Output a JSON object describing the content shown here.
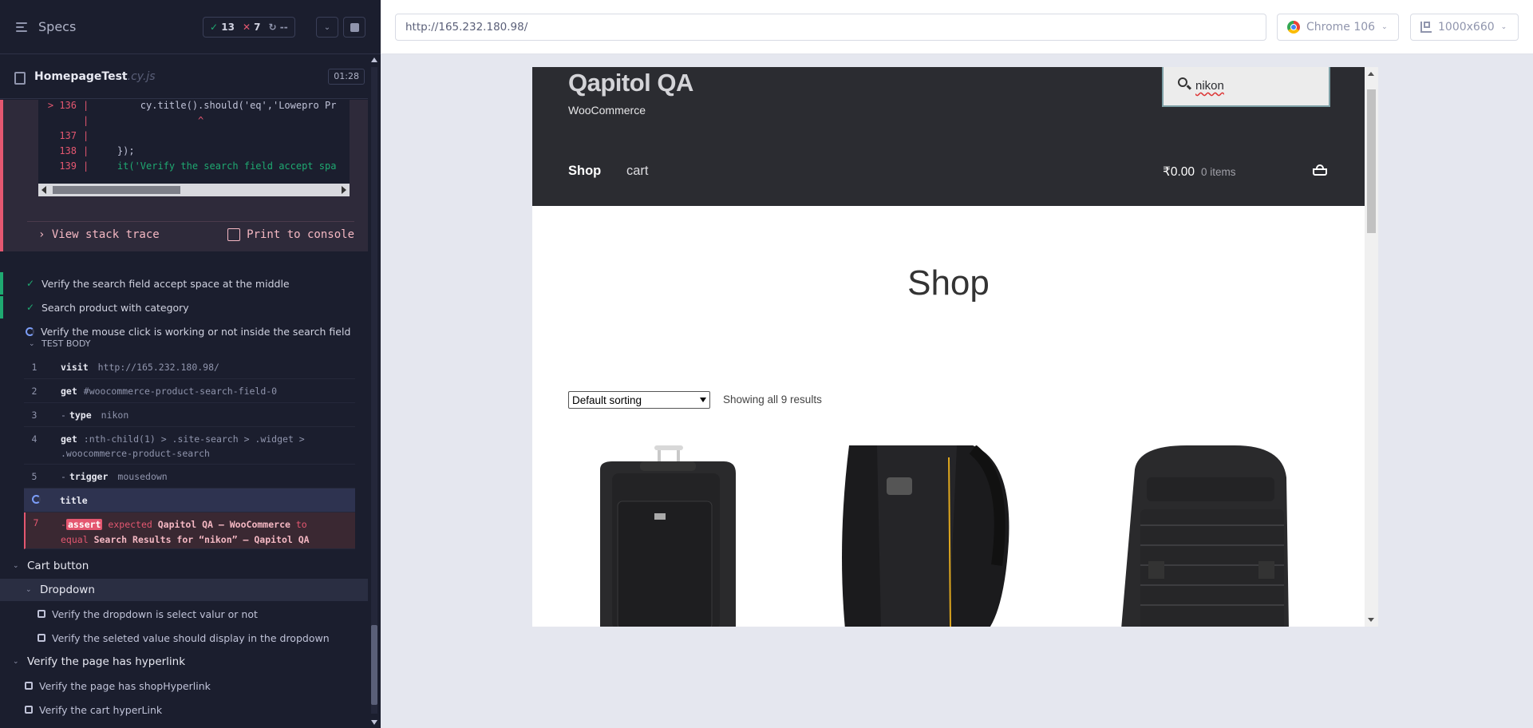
{
  "runner": {
    "specs_label": "Specs",
    "stats": {
      "passed": "13",
      "failed": "7",
      "pending": "--"
    },
    "spec": {
      "name": "HomepageTest",
      "ext": ".cy.js",
      "time": "01:28"
    },
    "code_lines": [
      {
        "ln": "> 136",
        "text": "        cy.title().should('eq','Lowepro Pr"
      },
      {
        "ln": "",
        "text": "                  ^"
      },
      {
        "ln": "137",
        "text": ""
      },
      {
        "ln": "138",
        "text": "    });"
      },
      {
        "ln": "139",
        "text": "    it('Verify the search field accept spa"
      }
    ],
    "error_actions": {
      "view_stack": "View stack trace",
      "print_console": "Print to console"
    },
    "tests": [
      {
        "label": "Verify the search field accept space at the middle",
        "state": "passed"
      },
      {
        "label": "Search product with category",
        "state": "passed"
      },
      {
        "label": "Verify the mouse click is working or not inside the search field",
        "state": "running"
      }
    ],
    "test_body_label": "TEST BODY",
    "commands": [
      {
        "num": "1",
        "name": "visit",
        "msg": "http://165.232.180.98/"
      },
      {
        "num": "2",
        "name": "get",
        "msg": "#woocommerce-product-search-field-0"
      },
      {
        "num": "3",
        "name": "type",
        "msg": "nikon"
      },
      {
        "num": "4",
        "name": "get",
        "msg": ":nth-child(1) > .site-search > .widget >",
        "msg2": ".woocommerce-product-search"
      },
      {
        "num": "5",
        "name": "trigger",
        "msg": "mousedown"
      },
      {
        "num": "",
        "name": "title",
        "msg": ""
      },
      {
        "num": "7",
        "assert_tag": "assert",
        "expected": "expected",
        "exp_val": "Qapitol QA – WooCommerce",
        "to": "to",
        "equal": "equal",
        "act_val": "Search Results for “nikon” – Qapitol QA"
      }
    ],
    "suites": [
      {
        "label": "Cart button"
      },
      {
        "label": "Dropdown"
      }
    ],
    "dropdown_tests": [
      "Verify the dropdown is select valur or not",
      "Verify the seleted value should display in the dropdown"
    ],
    "hyperlink_suite": "Verify the page has hyperlink",
    "hyperlink_tests": [
      "Verify the page has shopHyperlink",
      "Verify the cart hyperLink"
    ]
  },
  "preview": {
    "url": "http://165.232.180.98/",
    "browser": "Chrome 106",
    "viewport": "1000x660"
  },
  "site": {
    "title": "Qapitol QA",
    "tagline": "WooCommerce",
    "search_value": "nikon",
    "nav": {
      "shop": "Shop",
      "cart": "cart"
    },
    "cart_total": "₹0.00",
    "cart_count": "0 items",
    "page_title": "Shop",
    "sorting": "Default sorting",
    "results": "Showing all 9 results"
  }
}
